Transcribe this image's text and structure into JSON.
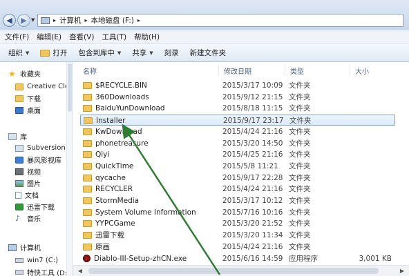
{
  "address": {
    "segments": [
      "计算机",
      "本地磁盘 (F:)"
    ]
  },
  "menu": [
    "文件(F)",
    "编辑(E)",
    "查看(V)",
    "工具(T)",
    "帮助(H)"
  ],
  "toolbar": {
    "organize": "组织",
    "open": "打开",
    "include_in_library": "包含到库中",
    "share": "共享",
    "burn": "刻录",
    "new_folder": "新建文件夹"
  },
  "sidebar": {
    "favorites": "收藏夹",
    "favorites_items": [
      "Creative Clo",
      "下载",
      "桌面"
    ],
    "libraries": "库",
    "library_items": [
      "Subversion",
      "暴风影视库",
      "视频",
      "图片",
      "文档",
      "迅雷下载",
      "音乐"
    ],
    "computer": "计算机",
    "drives": [
      "win7 (C:)",
      "特快工具 (D:)"
    ]
  },
  "columns": {
    "name": "名称",
    "modified": "修改日期",
    "type": "类型",
    "size": "大小"
  },
  "files": [
    {
      "name": "$RECYCLE.BIN",
      "date": "2015/3/17 10:09",
      "type": "文件夹",
      "size": "",
      "kind": "folder"
    },
    {
      "name": "360Downloads",
      "date": "2015/9/12 21:15",
      "type": "文件夹",
      "size": "",
      "kind": "folder"
    },
    {
      "name": "BaiduYunDownload",
      "date": "2015/8/18 11:15",
      "type": "文件夹",
      "size": "",
      "kind": "folder"
    },
    {
      "name": "Installer",
      "date": "2015/9/17 23:17",
      "type": "文件夹",
      "size": "",
      "kind": "folder"
    },
    {
      "name": "KwDownload",
      "date": "2015/4/24 21:16",
      "type": "文件夹",
      "size": "",
      "kind": "folder"
    },
    {
      "name": "phonetreasure",
      "date": "2015/3/20 14:50",
      "type": "文件夹",
      "size": "",
      "kind": "folder"
    },
    {
      "name": "Qiyi",
      "date": "2015/4/25 21:16",
      "type": "文件夹",
      "size": "",
      "kind": "folder"
    },
    {
      "name": "QuickTime",
      "date": "2015/5/8 11:21",
      "type": "文件夹",
      "size": "",
      "kind": "folder"
    },
    {
      "name": "qycache",
      "date": "2015/9/17 22:28",
      "type": "文件夹",
      "size": "",
      "kind": "folder"
    },
    {
      "name": "RECYCLER",
      "date": "2015/4/24 21:16",
      "type": "文件夹",
      "size": "",
      "kind": "folder"
    },
    {
      "name": "StormMedia",
      "date": "2015/3/17 10:12",
      "type": "文件夹",
      "size": "",
      "kind": "folder"
    },
    {
      "name": "System Volume Information",
      "date": "2015/7/16 10:16",
      "type": "文件夹",
      "size": "",
      "kind": "folder"
    },
    {
      "name": "YYPCGame",
      "date": "2015/3/20 21:52",
      "type": "文件夹",
      "size": "",
      "kind": "folder"
    },
    {
      "name": "迅雷下载",
      "date": "2015/3/20 11:34",
      "type": "文件夹",
      "size": "",
      "kind": "folder"
    },
    {
      "name": "原画",
      "date": "2015/4/24 21:16",
      "type": "文件夹",
      "size": "",
      "kind": "folder"
    },
    {
      "name": "Diablo-III-Setup-zhCN.exe",
      "date": "2015/6/16 14:59",
      "type": "应用程序",
      "size": "3,001 KB",
      "kind": "exe"
    }
  ],
  "selected_index": 3,
  "colors": {
    "arrow": "#2e7d32",
    "selection_border": "#7da2ce"
  }
}
